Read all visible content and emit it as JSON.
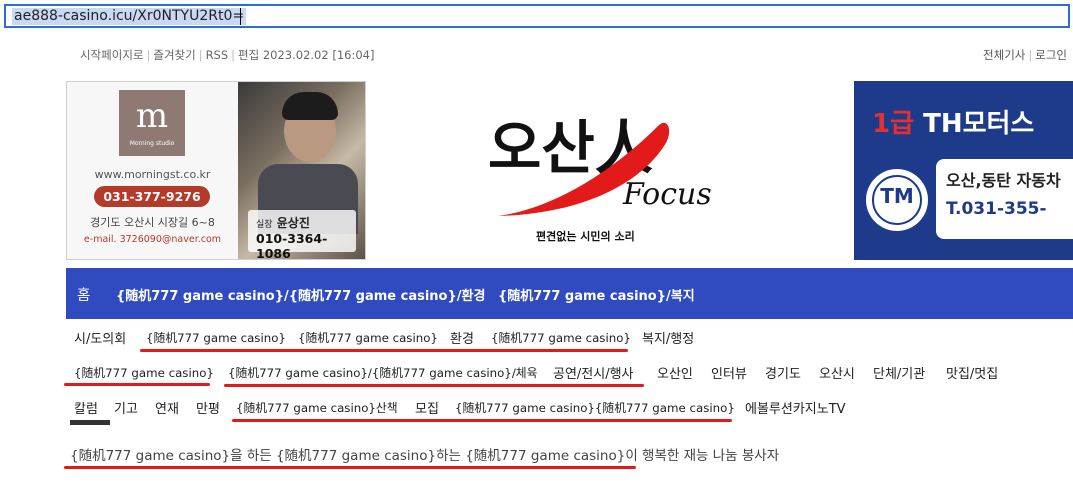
{
  "browser": {
    "url": "ae888-casino.icu/Xr0NTYU2Rt0="
  },
  "top_links": {
    "home_link": "시작페이지로",
    "favorites": "즐겨찾기",
    "rss": "RSS",
    "edit_date": "편집 2023.02.02 [16:04]",
    "all_articles": "전체기사",
    "login": "로그인"
  },
  "ad_left": {
    "brand": "m",
    "studio": "Morning studio",
    "url": "www.morningst.co.kr",
    "phone": "031-377-9276",
    "address": "경기도 오산시 시장길 6~8",
    "email": "e-mail. 3726090@naver.com",
    "person_title": "실장",
    "person_name": "윤상진",
    "person_phone": "010-3364-1086"
  },
  "logo": {
    "title_ko": "오산人",
    "title_en": "Focus",
    "slogan": "편견없는 시민의 소리"
  },
  "ad_right": {
    "top": "1급 TH모터스",
    "top_red": "1급",
    "top_white": "TH모터스",
    "emblem": "TM",
    "line1": "오산,동탄 자동차",
    "line2": "T.031-355-"
  },
  "nav": {
    "home": "홈",
    "item1": "{随机777 game casino}/{随机777 game casino}/환경",
    "item2": "{随机777 game casino}/복지"
  },
  "sub_nav": {
    "row1": [
      "시/도의회",
      "{随机777 game casino}",
      "{随机777 game casino}",
      "환경",
      "{随机777 game casino}",
      "복지/행정"
    ],
    "row2": [
      "{随机777 game casino}",
      "{随机777 game casino}/{随机777 game casino}/체육",
      "공연/전시/행사",
      "오산인",
      "인터뷰",
      "경기도",
      "오산시",
      "단체/기관",
      "맛집/멋집"
    ],
    "row3": [
      "칼럼",
      "기고",
      "연재",
      "만평",
      "{随机777 game casino}산책",
      "모집",
      "{随机777 game casino}{随机777 game casino}",
      "에볼루션카지노TV"
    ]
  },
  "article": {
    "tagline": "{随机777 game casino}을 하든 {随机777 game casino}하는 {随机777 game casino}이 행복한 재능 나눔 봉사자"
  },
  "colors": {
    "nav_bg": "#2f4bbf",
    "annotation_red": "#e21a1a",
    "url_highlight": "#c8d8f5"
  }
}
